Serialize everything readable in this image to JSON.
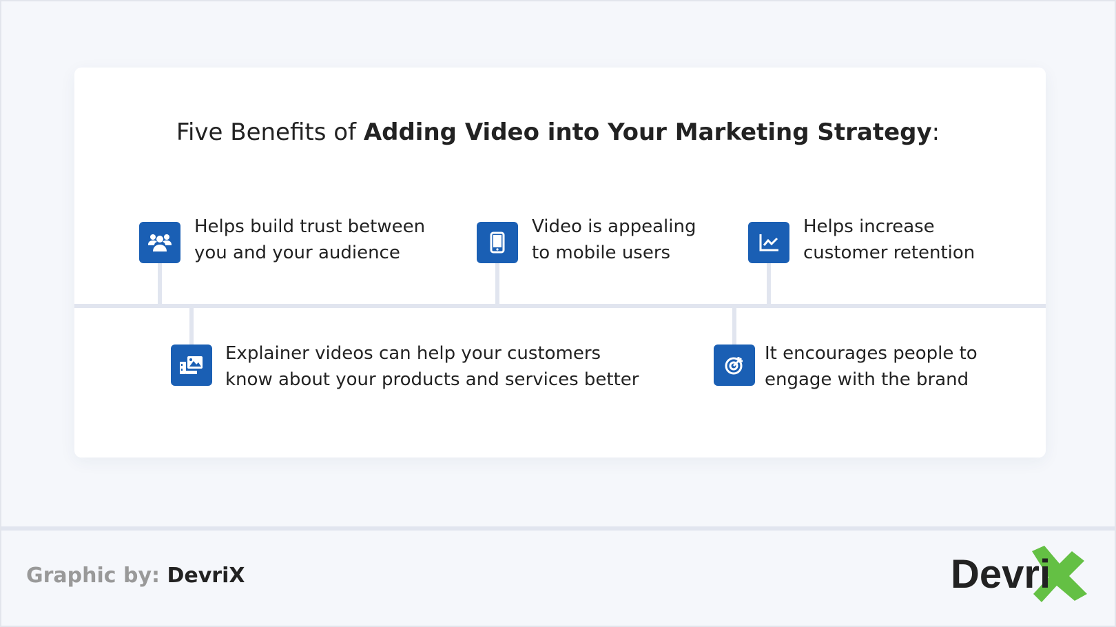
{
  "title": {
    "prefix": "Five Benefits of ",
    "bold": "Adding Video into Your Marketing Strategy",
    "suffix": ":"
  },
  "benefits": [
    {
      "icon": "users-icon",
      "line1": "Helps build trust between",
      "line2": "you and your audience"
    },
    {
      "icon": "mobile-icon",
      "line1": "Video is appealing",
      "line2": "to mobile users"
    },
    {
      "icon": "chart-line-icon",
      "line1": "Helps increase",
      "line2": "customer retention"
    },
    {
      "icon": "media-icon",
      "line1": "Explainer videos can help your customers",
      "line2": "know about your products and services better"
    },
    {
      "icon": "target-icon",
      "line1": "It encourages people to",
      "line2": "engage with the brand"
    }
  ],
  "footer": {
    "label": "Graphic by: ",
    "brand": "DevriX"
  },
  "logo": {
    "text": "Devri",
    "x": "X"
  },
  "colors": {
    "accent": "#1a5fb4",
    "line": "#e1e5ef",
    "logo_green": "#64c044"
  }
}
